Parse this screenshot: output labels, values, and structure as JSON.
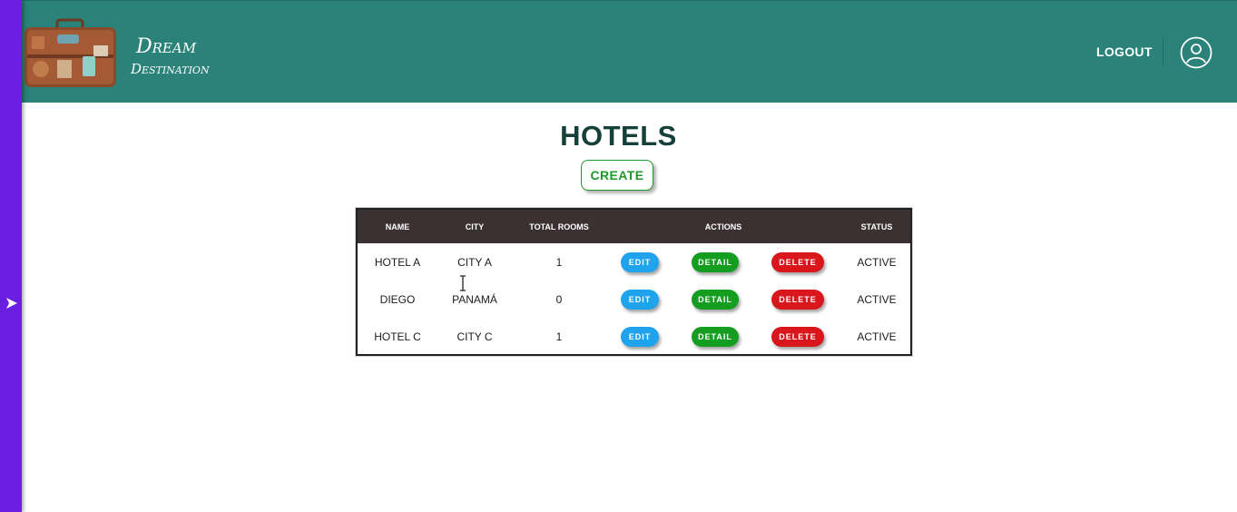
{
  "brand": {
    "line1": "Dream",
    "line2": "Destination"
  },
  "header": {
    "logout_label": "LOGOUT",
    "avatar_icon": "user-circle-icon",
    "background_color": "#2a8279"
  },
  "sidebar": {
    "toggle_icon": "arrow-right-icon",
    "background_color": "#6a1ee0"
  },
  "page": {
    "title": "HOTELS",
    "create_label": "CREATE"
  },
  "table": {
    "columns": {
      "name": "NAME",
      "city": "CITY",
      "total_rooms": "TOTAL ROOMS",
      "actions": "ACTIONS",
      "status": "STATUS"
    },
    "rows": [
      {
        "name": "HOTEL A",
        "city": "CITY A",
        "total_rooms": "1",
        "edit": "EDIT",
        "detail": "DETAIL",
        "delete": "DELETE",
        "status": "ACTIVE"
      },
      {
        "name": "DIEGO",
        "city": "PANAMÁ",
        "total_rooms": "0",
        "edit": "EDIT",
        "detail": "DETAIL",
        "delete": "DELETE",
        "status": "ACTIVE"
      },
      {
        "name": "HOTEL C",
        "city": "CITY C",
        "total_rooms": "1",
        "edit": "EDIT",
        "detail": "DETAIL",
        "delete": "DELETE",
        "status": "ACTIVE"
      }
    ]
  },
  "colors": {
    "edit": "#1fa3ec",
    "detail": "#159d20",
    "delete": "#d8161b",
    "table_header": "#3b3132"
  }
}
